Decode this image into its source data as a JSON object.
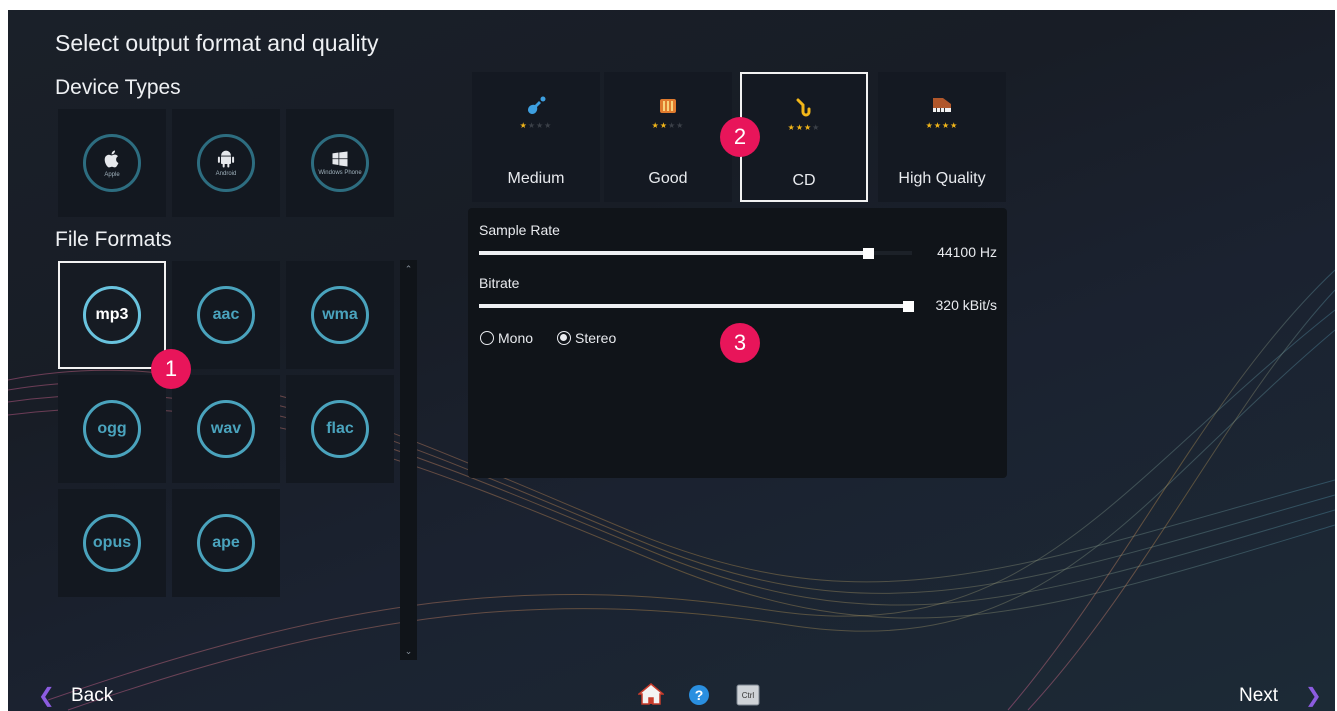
{
  "window": {
    "title": "Select output format and quality"
  },
  "sections": {
    "device_types": "Device Types",
    "file_formats": "File Formats"
  },
  "device_types": [
    {
      "name": "apple",
      "label": "Apple"
    },
    {
      "name": "android",
      "label": "Android"
    },
    {
      "name": "windows",
      "label": "Windows Phone"
    }
  ],
  "formats": [
    {
      "label": "mp3",
      "selected": true
    },
    {
      "label": "aac"
    },
    {
      "label": "wma"
    },
    {
      "label": "ogg"
    },
    {
      "label": "wav"
    },
    {
      "label": "flac"
    },
    {
      "label": "opus"
    },
    {
      "label": "ape"
    }
  ],
  "quality": [
    {
      "label": "Medium",
      "stars": 1,
      "icon": "guitar-icon"
    },
    {
      "label": "Good",
      "stars": 2,
      "icon": "xylophone-icon"
    },
    {
      "label": "CD",
      "stars": 3,
      "icon": "saxophone-icon",
      "selected": true
    },
    {
      "label": "High Quality",
      "stars": 4,
      "icon": "piano-icon"
    }
  ],
  "settings": {
    "sample_rate_label": "Sample Rate",
    "sample_rate_value": "44100 Hz",
    "bitrate_label": "Bitrate",
    "bitrate_value": "320 kBit/s",
    "mono_label": "Mono",
    "stereo_label": "Stereo",
    "channel": "stereo"
  },
  "callouts": [
    "1",
    "2",
    "3"
  ],
  "footer": {
    "back_label": "Back",
    "next_label": "Next",
    "ctrl_label": "Ctrl"
  },
  "colors": {
    "accent": "#8c5ce0",
    "callout": "#e8155a",
    "format_ring": "#4aa3bd",
    "star": "#f2b619"
  }
}
